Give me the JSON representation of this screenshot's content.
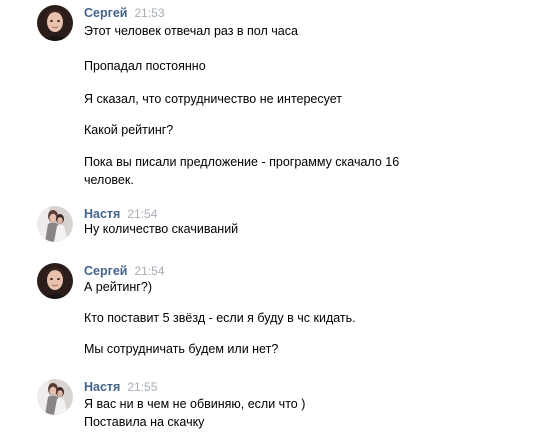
{
  "messages": [
    {
      "author": "Сергей",
      "time": "21:53",
      "avatar": "sergey-avatar",
      "lines": [
        "Этот человек отвечал раз в пол часа",
        "Пропадал постоянно",
        "Я сказал, что сотрудничество не интересует",
        "Какой рейтинг?",
        "Пока вы писали предложение - программу скачало 16",
        "человек."
      ]
    },
    {
      "author": "Настя",
      "time": "21:54",
      "avatar": "nastya-avatar",
      "lines": [
        "Ну количество скачиваний"
      ]
    },
    {
      "author": "Сергей",
      "time": "21:54",
      "avatar": "sergey-avatar",
      "lines": [
        "А рейтинг?)",
        "Кто поставит 5 звёзд - если я буду в чс кидать.",
        "Мы сотрудничать будем или нет?"
      ]
    },
    {
      "author": "Настя",
      "time": "21:55",
      "avatar": "nastya-avatar",
      "lines": [
        "Я вас ни в чем не обвиняю, если что )",
        "Поставила на скачку"
      ]
    }
  ],
  "colors": {
    "author": "#42648b",
    "time": "#a6adb5",
    "text": "#000000",
    "background": "#ffffff"
  }
}
